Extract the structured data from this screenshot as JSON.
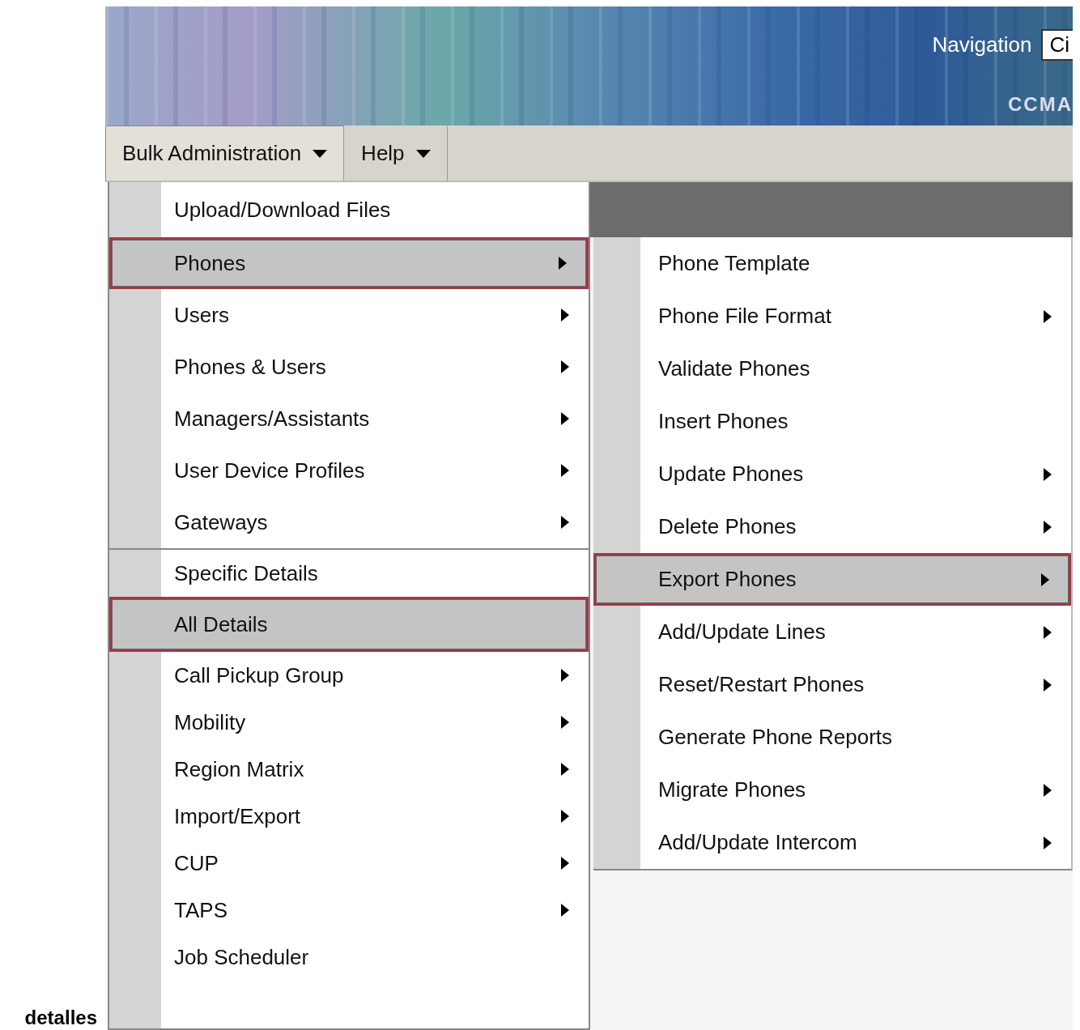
{
  "banner": {
    "navigation_label": "Navigation",
    "navigation_select": "Ci",
    "product": "CCMA"
  },
  "menubar": [
    {
      "label": "Bulk Administration",
      "selected": true
    },
    {
      "label": "Help",
      "selected": false
    }
  ],
  "menu": {
    "groups": [
      [
        {
          "label": "Upload/Download Files",
          "submenu": false,
          "selected": false
        },
        {
          "label": "Phones",
          "submenu": true,
          "selected": true
        },
        {
          "label": "Users",
          "submenu": true,
          "selected": false
        },
        {
          "label": "Phones & Users",
          "submenu": true,
          "selected": false
        },
        {
          "label": "Managers/Assistants",
          "submenu": true,
          "selected": false
        },
        {
          "label": "User Device Profiles",
          "submenu": true,
          "selected": false
        },
        {
          "label": "Gateways",
          "submenu": true,
          "selected": false
        }
      ],
      [
        {
          "label": "Specific Details",
          "submenu": false,
          "selected": false
        },
        {
          "label": "All Details",
          "submenu": false,
          "selected": true
        },
        {
          "label": "Call Pickup Group",
          "submenu": true,
          "selected": false
        },
        {
          "label": "Mobility",
          "submenu": true,
          "selected": false
        },
        {
          "label": "Region Matrix",
          "submenu": true,
          "selected": false
        },
        {
          "label": "Import/Export",
          "submenu": true,
          "selected": false
        },
        {
          "label": "CUP",
          "submenu": true,
          "selected": false
        },
        {
          "label": "TAPS",
          "submenu": true,
          "selected": false
        },
        {
          "label": "Job Scheduler",
          "submenu": false,
          "selected": false
        }
      ]
    ]
  },
  "submenu": {
    "items": [
      {
        "label": "Phone Template",
        "submenu": false,
        "selected": false
      },
      {
        "label": "Phone File Format",
        "submenu": true,
        "selected": false
      },
      {
        "label": "Validate Phones",
        "submenu": false,
        "selected": false
      },
      {
        "label": "Insert Phones",
        "submenu": false,
        "selected": false
      },
      {
        "label": "Update Phones",
        "submenu": true,
        "selected": false
      },
      {
        "label": "Delete Phones",
        "submenu": true,
        "selected": false
      },
      {
        "label": "Export Phones",
        "submenu": true,
        "selected": true
      },
      {
        "label": "Add/Update Lines",
        "submenu": true,
        "selected": false
      },
      {
        "label": "Reset/Restart Phones",
        "submenu": true,
        "selected": false
      },
      {
        "label": "Generate Phone Reports",
        "submenu": false,
        "selected": false
      },
      {
        "label": "Migrate Phones",
        "submenu": true,
        "selected": false
      },
      {
        "label": "Add/Update Intercom",
        "submenu": true,
        "selected": false
      }
    ]
  },
  "caption": "detalles"
}
